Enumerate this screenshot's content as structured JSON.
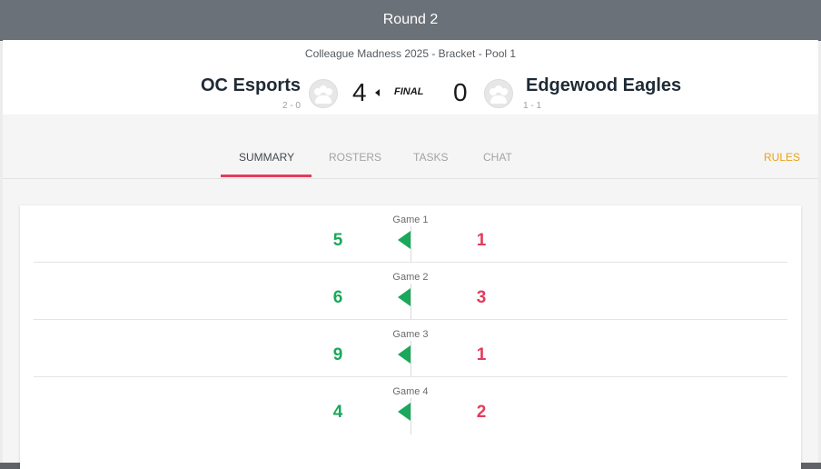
{
  "header": {
    "title": "Round 2"
  },
  "match": {
    "subtitle": "Colleague Madness 2025 - Bracket - Pool 1",
    "home": {
      "name": "OC Esports",
      "record": "2 - 0",
      "score": "4",
      "avatar_icon": "team-avatar-icon"
    },
    "away": {
      "name": "Edgewood Eagles",
      "record": "1 - 1",
      "score": "0",
      "avatar_icon": "team-avatar-icon"
    },
    "status": "FINAL"
  },
  "tabs": [
    {
      "label": "SUMMARY",
      "active": true
    },
    {
      "label": "ROSTERS",
      "active": false
    },
    {
      "label": "TASKS",
      "active": false
    },
    {
      "label": "CHAT",
      "active": false
    }
  ],
  "rules_label": "RULES",
  "games": [
    {
      "label": "Game 1",
      "home_score": "5",
      "away_score": "1",
      "winner_icon": "winner-flag-left-icon"
    },
    {
      "label": "Game 2",
      "home_score": "6",
      "away_score": "3",
      "winner_icon": "winner-flag-left-icon"
    },
    {
      "label": "Game 3",
      "home_score": "9",
      "away_score": "1",
      "winner_icon": "winner-flag-left-icon"
    },
    {
      "label": "Game 4",
      "home_score": "4",
      "away_score": "2",
      "winner_icon": "winner-flag-left-icon"
    }
  ],
  "colors": {
    "header_bg": "#6b7178",
    "win": "#1aa85a",
    "loss": "#e23d5a",
    "tab_underline": "#e23d5a",
    "rules": "#e9a21a"
  }
}
